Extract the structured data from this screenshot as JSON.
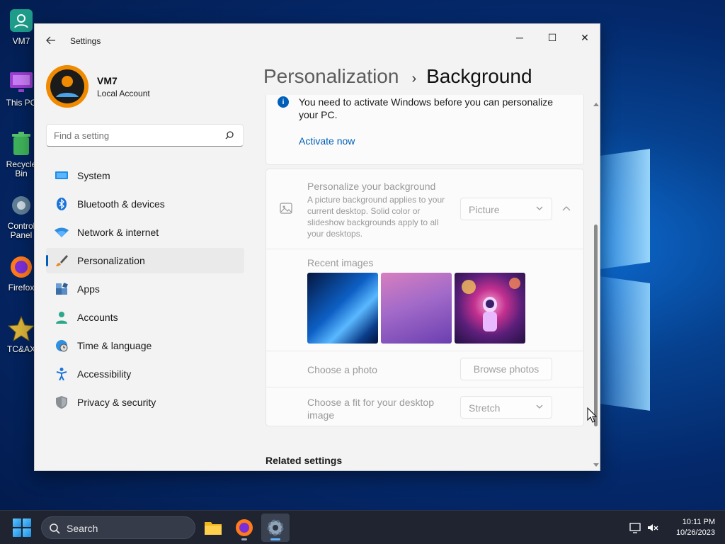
{
  "desktop": {
    "icons": [
      {
        "label": "VM7",
        "icon": "user-folder-icon"
      },
      {
        "label": "This PC",
        "icon": "monitor-icon"
      },
      {
        "label": "Recycle Bin",
        "icon": "recycle-bin-icon"
      },
      {
        "label": "Control Panel",
        "icon": "control-panel-icon"
      },
      {
        "label": "Firefox",
        "icon": "firefox-icon"
      },
      {
        "label": "TC&AX",
        "icon": "star-icon"
      }
    ]
  },
  "window": {
    "app_title": "Settings",
    "controls": {
      "minimize": "─",
      "maximize": "☐",
      "close": "✕"
    }
  },
  "profile": {
    "name": "VM7",
    "account_type": "Local Account"
  },
  "search": {
    "placeholder": "Find a setting"
  },
  "nav": {
    "items": [
      {
        "label": "System",
        "icon": "system-icon",
        "active": false
      },
      {
        "label": "Bluetooth & devices",
        "icon": "bluetooth-icon",
        "active": false
      },
      {
        "label": "Network & internet",
        "icon": "wifi-icon",
        "active": false
      },
      {
        "label": "Personalization",
        "icon": "brush-icon",
        "active": true
      },
      {
        "label": "Apps",
        "icon": "apps-icon",
        "active": false
      },
      {
        "label": "Accounts",
        "icon": "accounts-icon",
        "active": false
      },
      {
        "label": "Time & language",
        "icon": "globe-clock-icon",
        "active": false
      },
      {
        "label": "Accessibility",
        "icon": "accessibility-icon",
        "active": false
      },
      {
        "label": "Privacy & security",
        "icon": "shield-icon",
        "active": false
      }
    ]
  },
  "breadcrumb": {
    "parent": "Personalization",
    "separator": "›",
    "current": "Background"
  },
  "activation_notice": {
    "message": "You need to activate Windows before you can personalize your PC.",
    "link": "Activate now"
  },
  "background_settings": {
    "title": "Personalize your background",
    "description": "A picture background applies to your current desktop. Solid color or slideshow backgrounds apply to all your desktops.",
    "type_value": "Picture",
    "recent_images_label": "Recent images",
    "recent_images": [
      "windows-blue-wallpaper",
      "purple-gradient-wallpaper",
      "astronaut-wallpaper"
    ],
    "choose_photo_label": "Choose a photo",
    "browse_button": "Browse photos",
    "fit_label": "Choose a fit for your desktop image",
    "fit_value": "Stretch"
  },
  "related_settings": {
    "title": "Related settings"
  },
  "taskbar": {
    "search_label": "Search",
    "apps": [
      "file-explorer-icon",
      "firefox-icon",
      "settings-icon"
    ],
    "time": "10:11 PM",
    "date": "10/26/2023"
  },
  "colors": {
    "accent": "#005fb8",
    "taskbar": "#1f2430"
  }
}
